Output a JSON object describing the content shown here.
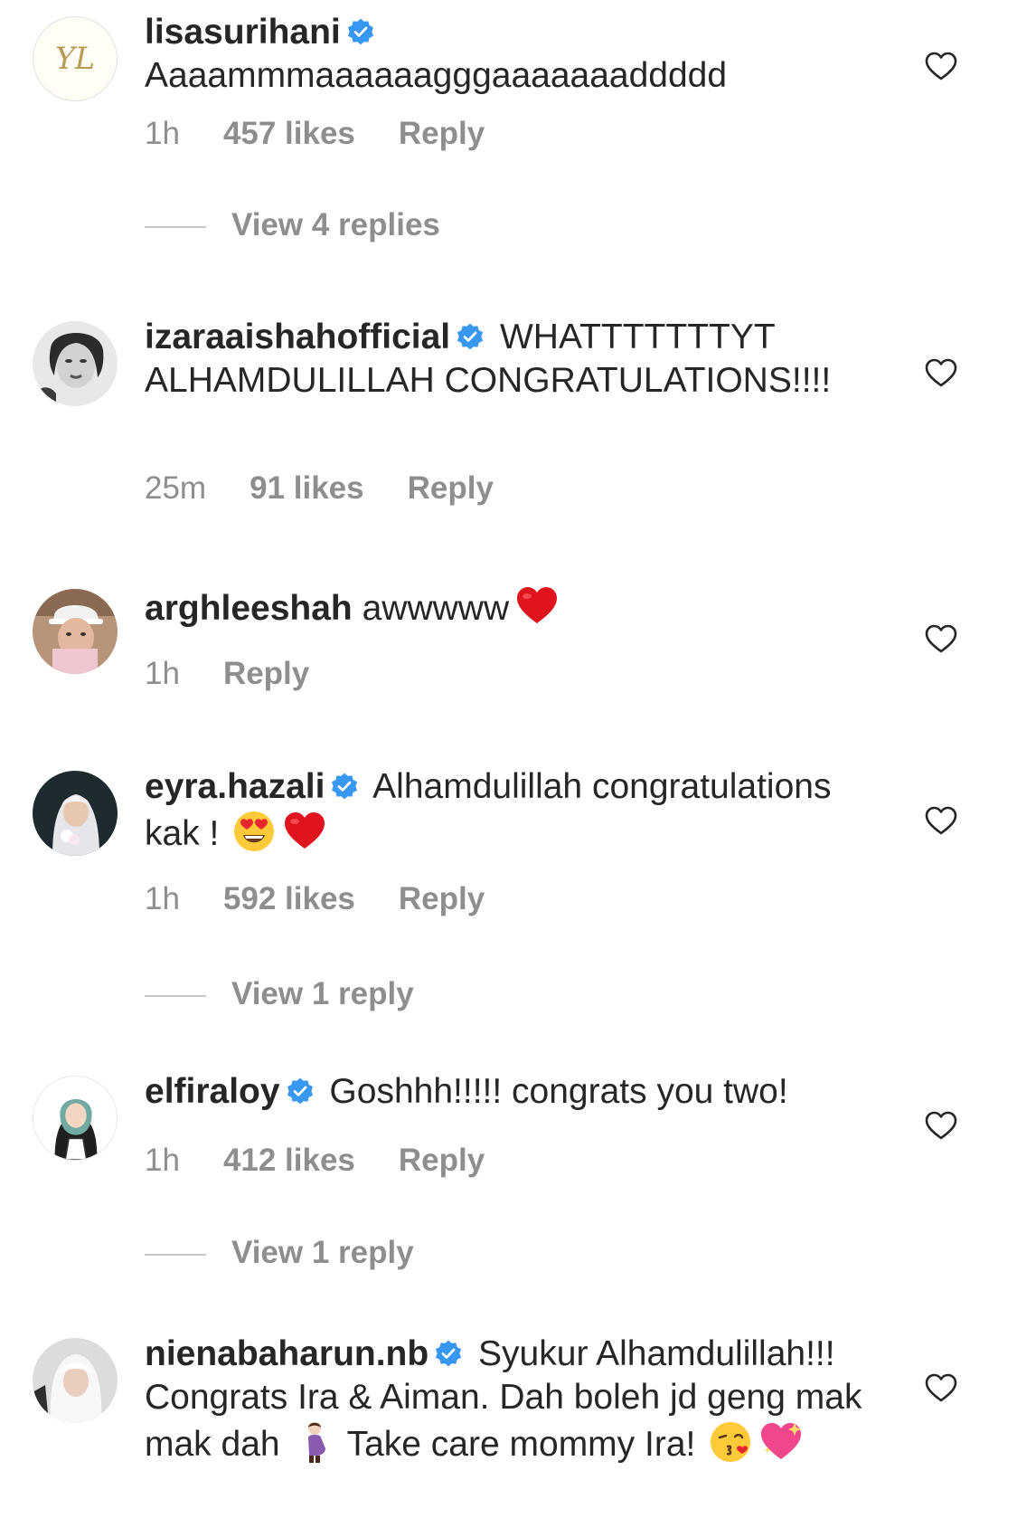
{
  "comments": [
    {
      "username": "lisasurihani",
      "verified": true,
      "text": "Aaaammmaaaaaagggaaaaaaaddddd",
      "time": "1h",
      "likes": "457 likes",
      "reply": "Reply",
      "view_replies": "View 4 replies",
      "avatar_monogram": "YL"
    },
    {
      "username": "izaraaishahofficial",
      "verified": true,
      "text": "WHATTTTTTTYT ALHAMDULILLAH CONGRATULATIONS!!!!",
      "time": "25m",
      "likes": "91 likes",
      "reply": "Reply"
    },
    {
      "username": "arghleeshah",
      "verified": false,
      "text": "awwwww",
      "emojis": [
        "red-heart"
      ],
      "time": "1h",
      "reply": "Reply"
    },
    {
      "username": "eyra.hazali",
      "verified": true,
      "text": "Alhamdulillah congratulations kak !",
      "emojis": [
        "heart-eyes",
        "red-heart"
      ],
      "time": "1h",
      "likes": "592 likes",
      "reply": "Reply",
      "view_replies": "View 1 reply"
    },
    {
      "username": "elfiraloy",
      "verified": true,
      "text": "Goshhh!!!!! congrats you two!",
      "time": "1h",
      "likes": "412 likes",
      "reply": "Reply",
      "view_replies": "View 1 reply"
    },
    {
      "username": "nienabaharun.nb",
      "verified": true,
      "text_part1": "Syukur Alhamdulillah!!! Congrats Ira & Aiman. Dah boleh jd geng mak mak dah",
      "text_part2": "Take care mommy Ira!",
      "emojis": [
        "pregnant-woman",
        "face-blowing-kiss",
        "sparkling-heart"
      ]
    }
  ],
  "icons": {
    "like": "heart-outline-icon",
    "verified": "verified-badge-icon"
  },
  "colors": {
    "text": "#262626",
    "secondary": "#8e8e8e",
    "verified": "#3897f0",
    "divider": "#c7c7c7"
  }
}
